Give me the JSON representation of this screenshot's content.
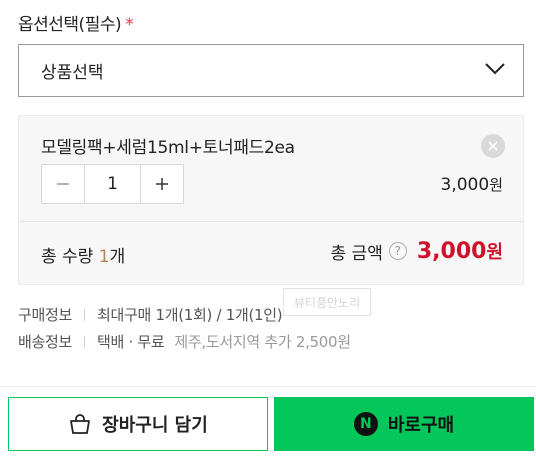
{
  "option": {
    "label": "옵션선택(필수)",
    "required_mark": "*",
    "select_value": "상품선택",
    "chevron_icon": "chevron-down-icon"
  },
  "item": {
    "name": "모델링팩+세럼15ml+토너패드2ea",
    "remove_icon": "close-icon",
    "quantity": "1",
    "minus_icon": "minus-icon",
    "plus_icon": "plus-icon",
    "price": "3,000",
    "price_unit": "원"
  },
  "totals": {
    "qty_prefix": "총 수량 ",
    "qty_num": "1",
    "qty_suffix": "개",
    "amount_label": "총 금액",
    "help_icon": "?",
    "amount": "3,000",
    "amount_unit": "원",
    "accent_color": "#d0112b"
  },
  "watermark": "뷰티풍만노리",
  "purchase_info": {
    "label": "구매정보",
    "value": "최대구매 1개(1회) / 1개(1인)"
  },
  "shipping_info": {
    "label": "배송정보",
    "value": "택배 · 무료",
    "sub": "제주,도서지역 추가 2,500원"
  },
  "buttons": {
    "cart_label": "장바구니 담기",
    "cart_icon": "shopping-bag-icon",
    "buy_label": "바로구매",
    "buy_logo": "N",
    "brand_color": "#03c75a"
  }
}
